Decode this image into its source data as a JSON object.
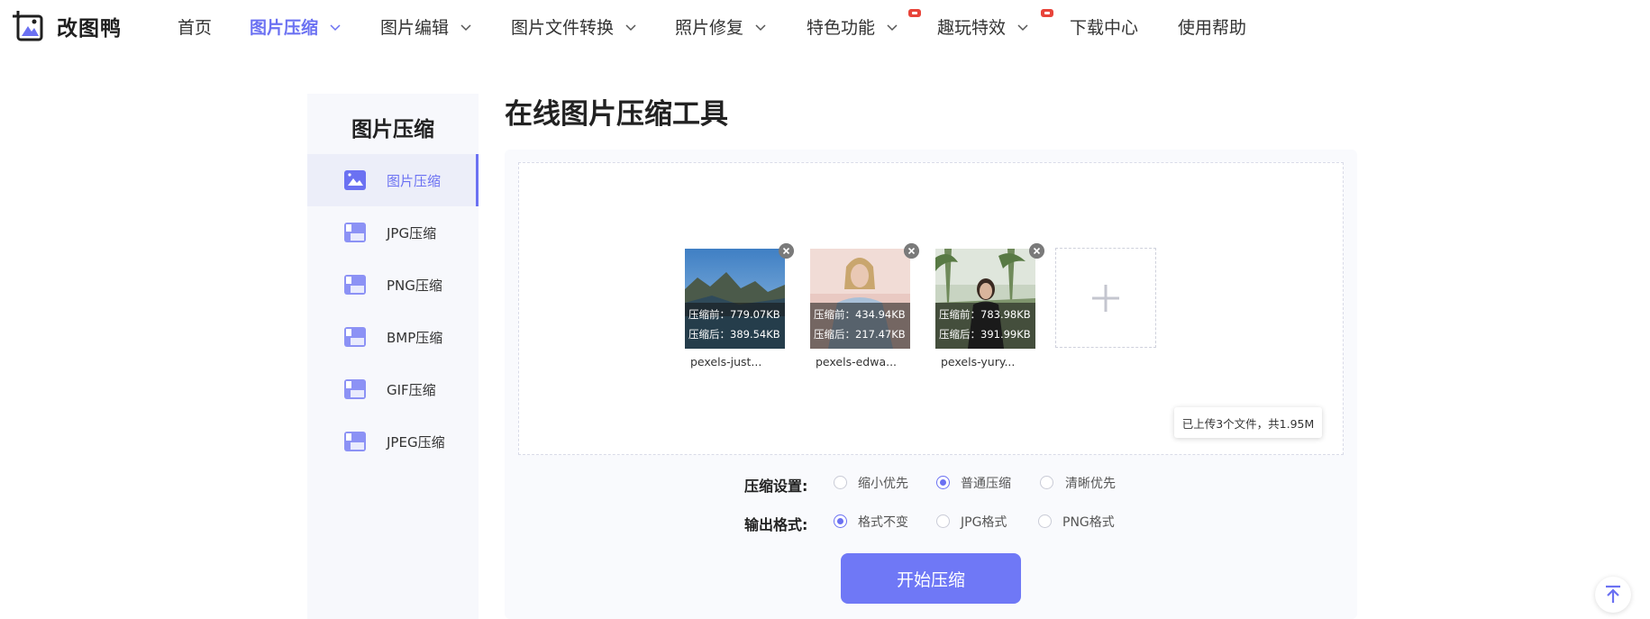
{
  "brand": {
    "name": "改图鸭",
    "accent": "#6b71f2"
  },
  "nav": {
    "items": [
      {
        "label": "首页",
        "dropdown": false,
        "active": false,
        "badge": false
      },
      {
        "label": "图片压缩",
        "dropdown": true,
        "active": true,
        "badge": false
      },
      {
        "label": "图片编辑",
        "dropdown": true,
        "active": false,
        "badge": false
      },
      {
        "label": "图片文件转换",
        "dropdown": true,
        "active": false,
        "badge": false
      },
      {
        "label": "照片修复",
        "dropdown": true,
        "active": false,
        "badge": false
      },
      {
        "label": "特色功能",
        "dropdown": true,
        "active": false,
        "badge": true
      },
      {
        "label": "趣玩特效",
        "dropdown": true,
        "active": false,
        "badge": true
      },
      {
        "label": "下载中心",
        "dropdown": false,
        "active": false,
        "badge": false
      },
      {
        "label": "使用帮助",
        "dropdown": false,
        "active": false,
        "badge": false
      }
    ]
  },
  "sidebar": {
    "title": "图片压缩",
    "items": [
      {
        "label": "图片压缩",
        "icon": "image-compress-icon",
        "active": true
      },
      {
        "label": "JPG压缩",
        "icon": "jpg-file-icon",
        "active": false
      },
      {
        "label": "PNG压缩",
        "icon": "png-file-icon",
        "active": false
      },
      {
        "label": "BMP压缩",
        "icon": "bmp-file-icon",
        "active": false
      },
      {
        "label": "GIF压缩",
        "icon": "gif-file-icon",
        "active": false
      },
      {
        "label": "JPEG压缩",
        "icon": "jpeg-file-icon",
        "active": false
      }
    ]
  },
  "main": {
    "title": "在线图片压缩工具",
    "files": [
      {
        "name": "pexels-just...",
        "before": "压缩前：779.07KB",
        "after": "压缩后：389.54KB",
        "scene": "mountain-lake"
      },
      {
        "name": "pexels-edwa...",
        "before": "压缩前：434.94KB",
        "after": "压缩后：217.47KB",
        "scene": "woman-portrait"
      },
      {
        "name": "pexels-yury...",
        "before": "压缩前：783.98KB",
        "after": "压缩后：391.99KB",
        "scene": "woman-palms"
      }
    ],
    "upload_status": "已上传3个文件，共1.95M",
    "compress_setting": {
      "label": "压缩设置:",
      "options": [
        "缩小优先",
        "普通压缩",
        "清晰优先"
      ],
      "selected": "普通压缩"
    },
    "output_format": {
      "label": "输出格式:",
      "options": [
        "格式不变",
        "JPG格式",
        "PNG格式"
      ],
      "selected": "格式不变"
    },
    "start_button": "开始压缩"
  }
}
